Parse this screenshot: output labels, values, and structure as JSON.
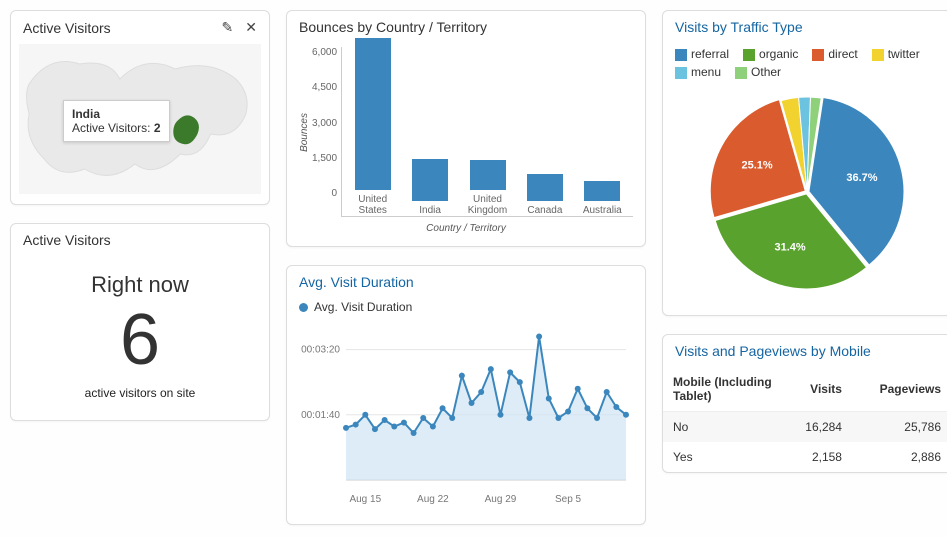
{
  "active_visitors_map": {
    "title": "Active Visitors",
    "tooltip_country": "India",
    "tooltip_label": "Active Visitors:",
    "tooltip_value": "2"
  },
  "active_visitors_now": {
    "title": "Active Visitors",
    "heading": "Right now",
    "value": "6",
    "sub": "active visitors on site"
  },
  "bounces": {
    "title": "Bounces by Country / Territory",
    "ylabel": "Bounces",
    "xlabel": "Country / Territory"
  },
  "duration": {
    "title": "Avg. Visit Duration",
    "legend": "Avg. Visit Duration"
  },
  "traffic": {
    "title": "Visits by Traffic Type"
  },
  "mobile": {
    "title": "Visits and Pageviews by Mobile",
    "h1": "Mobile (Including Tablet)",
    "h2": "Visits",
    "h3": "Pageviews",
    "rows": [
      {
        "k": "No",
        "v": "16,284",
        "p": "25,786"
      },
      {
        "k": "Yes",
        "v": "2,158",
        "p": "2,886"
      }
    ]
  },
  "chart_data": [
    {
      "id": "bounces",
      "type": "bar",
      "title": "Bounces by Country / Territory",
      "xlabel": "Country / Territory",
      "ylabel": "Bounces",
      "ylim": [
        0,
        6000
      ],
      "yticks": [
        0,
        1500,
        3000,
        4500,
        6000
      ],
      "categories": [
        "United States",
        "India",
        "United Kingdom",
        "Canada",
        "Australia"
      ],
      "values": [
        6100,
        1700,
        1200,
        1100,
        800
      ]
    },
    {
      "id": "duration",
      "type": "line",
      "title": "Avg. Visit Duration",
      "series_name": "Avg. Visit Duration",
      "y_ticks": [
        "00:01:40",
        "00:03:20"
      ],
      "y_seconds": [
        100,
        200
      ],
      "x_ticks": [
        "Aug 15",
        "Aug 22",
        "Aug 29",
        "Sep 5"
      ],
      "x": [
        "Aug 13",
        "Aug 14",
        "Aug 15",
        "Aug 16",
        "Aug 17",
        "Aug 18",
        "Aug 19",
        "Aug 20",
        "Aug 21",
        "Aug 22",
        "Aug 23",
        "Aug 24",
        "Aug 25",
        "Aug 26",
        "Aug 27",
        "Aug 28",
        "Aug 29",
        "Aug 30",
        "Aug 31",
        "Sep 1",
        "Sep 2",
        "Sep 3",
        "Sep 4",
        "Sep 5",
        "Sep 6",
        "Sep 7",
        "Sep 8",
        "Sep 9",
        "Sep 10",
        "Sep 11"
      ],
      "values_seconds": [
        80,
        85,
        100,
        78,
        92,
        82,
        88,
        72,
        95,
        82,
        110,
        95,
        160,
        118,
        135,
        170,
        100,
        165,
        150,
        95,
        220,
        125,
        95,
        105,
        140,
        110,
        95,
        135,
        112,
        100
      ]
    },
    {
      "id": "traffic",
      "type": "pie",
      "title": "Visits by Traffic Type",
      "series": [
        {
          "name": "referral",
          "value": 36.7,
          "color": "#3b87bd"
        },
        {
          "name": "organic",
          "value": 31.4,
          "color": "#5aa22e"
        },
        {
          "name": "direct",
          "value": 25.1,
          "color": "#d95b2e"
        },
        {
          "name": "twitter",
          "value": 3.0,
          "color": "#f2d22e"
        },
        {
          "name": "menu",
          "value": 2.0,
          "color": "#6bc3e0"
        },
        {
          "name": "Other",
          "value": 1.8,
          "color": "#8fd07a"
        }
      ],
      "labels_shown": [
        "36.7%",
        "31.4%",
        "25.1%"
      ]
    },
    {
      "id": "mobile",
      "type": "table",
      "title": "Visits and Pageviews by Mobile",
      "columns": [
        "Mobile (Including Tablet)",
        "Visits",
        "Pageviews"
      ],
      "rows": [
        [
          "No",
          16284,
          25786
        ],
        [
          "Yes",
          2158,
          2886
        ]
      ]
    }
  ]
}
